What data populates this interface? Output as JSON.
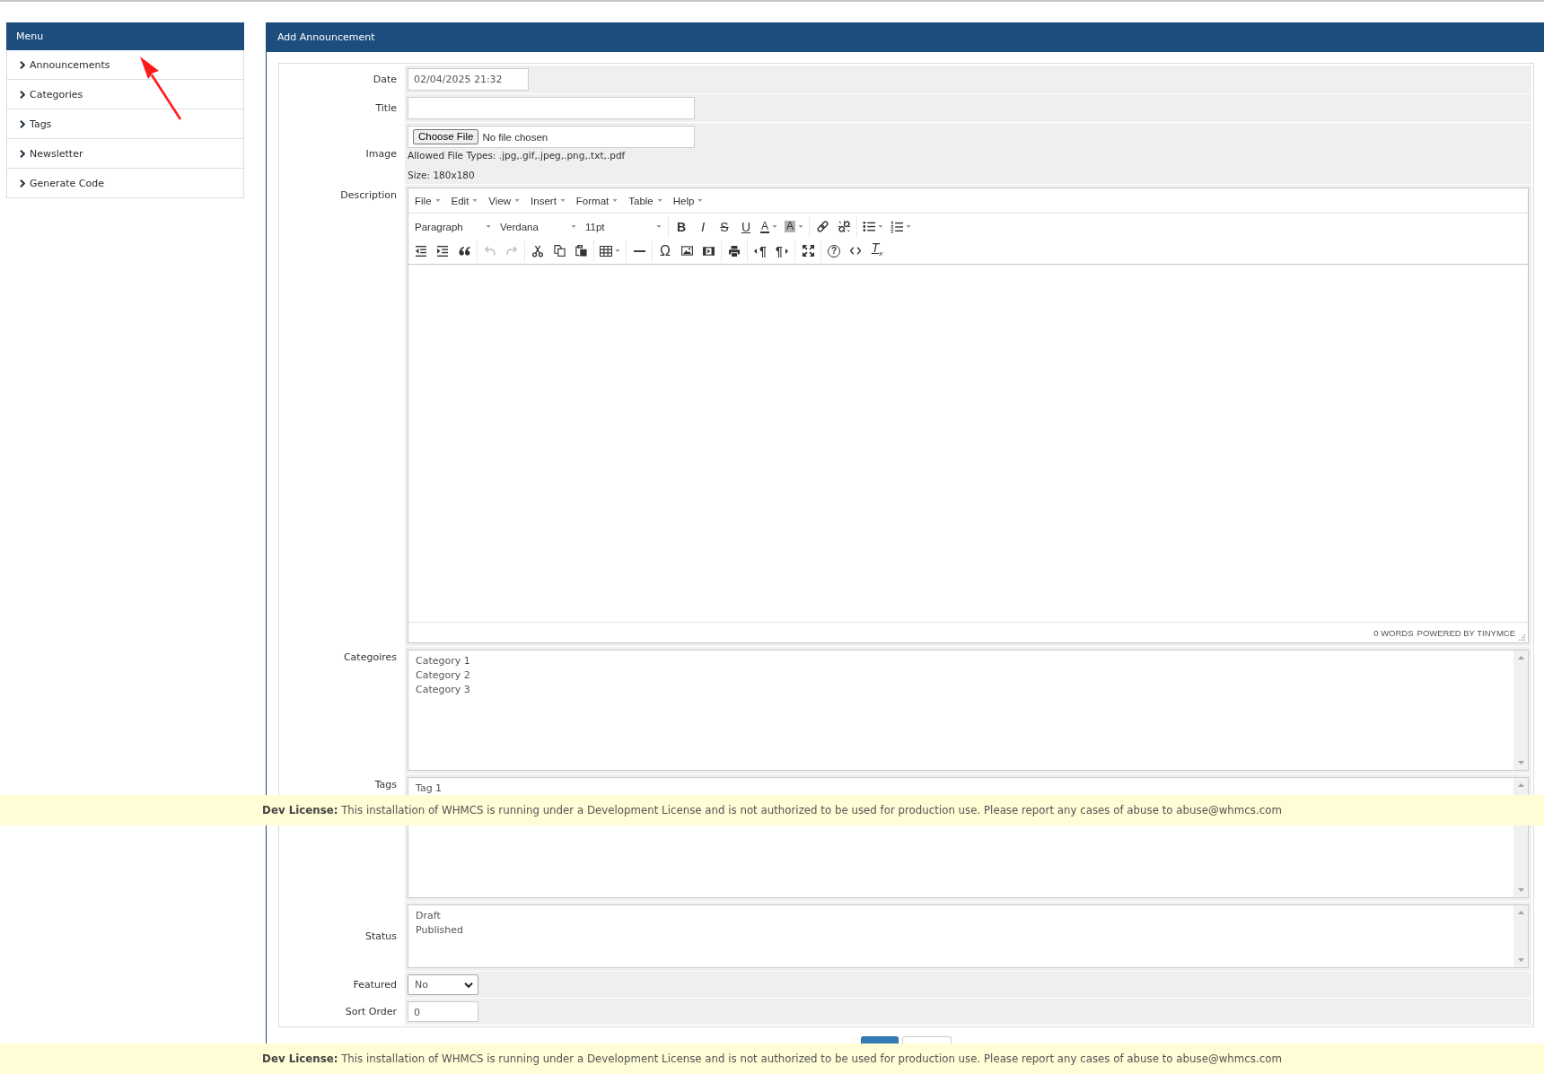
{
  "sidebar": {
    "title": "Menu",
    "items": [
      {
        "label": "Announcements"
      },
      {
        "label": "Categories"
      },
      {
        "label": "Tags"
      },
      {
        "label": "Newsletter"
      },
      {
        "label": "Generate Code"
      }
    ]
  },
  "panel": {
    "title": "Add Announcement"
  },
  "form": {
    "fields": [
      {
        "kind": "datetime",
        "label": "Date",
        "value": "02/04/2025 21:32"
      },
      {
        "kind": "text",
        "label": "Title"
      },
      {
        "kind": "file",
        "label": "Image",
        "button": "Choose File",
        "status": "No file chosen",
        "hints": [
          "Allowed File Types: .jpg,.gif,.jpeg,.png,.txt,.pdf",
          "Size: 180x180"
        ]
      },
      {
        "kind": "editor",
        "label": "Description",
        "menu": [
          {
            "label": "File"
          },
          {
            "label": "Edit"
          },
          {
            "label": "View"
          },
          {
            "label": "Insert"
          },
          {
            "label": "Format"
          },
          {
            "label": "Table"
          },
          {
            "label": "Help"
          }
        ],
        "toolbar": [
          [
            [
              {
                "kind": "blockformat",
                "text": "Paragraph",
                "disabled": false,
                "dropdown": true
              },
              {
                "kind": "fontfamily",
                "text": "Verdana",
                "disabled": false,
                "dropdown": true
              },
              {
                "kind": "fontsize",
                "text": "11pt",
                "disabled": false,
                "dropdown": true
              }
            ],
            [
              {
                "kind": "bold",
                "text": "B",
                "disabled": false,
                "dropdown": false
              },
              {
                "kind": "italic",
                "text": "I",
                "disabled": false,
                "dropdown": false
              },
              {
                "kind": "strikethrough",
                "text": "S",
                "disabled": false,
                "dropdown": false
              },
              {
                "kind": "underline",
                "text": "U",
                "disabled": false,
                "dropdown": false
              },
              {
                "kind": "forecolor",
                "text": "A",
                "disabled": false,
                "dropdown": true
              },
              {
                "kind": "backcolor",
                "text": "A",
                "disabled": false,
                "dropdown": true
              }
            ],
            [
              {
                "kind": "link",
                "disabled": false,
                "dropdown": false
              },
              {
                "kind": "unlink",
                "disabled": false,
                "dropdown": false
              }
            ],
            [
              {
                "kind": "bullist",
                "disabled": false,
                "dropdown": true
              },
              {
                "kind": "numlist",
                "disabled": false,
                "dropdown": true
              }
            ]
          ],
          [
            [
              {
                "kind": "outdent",
                "disabled": false,
                "dropdown": false
              },
              {
                "kind": "indent",
                "disabled": false,
                "dropdown": false
              },
              {
                "kind": "blockquote",
                "disabled": false,
                "dropdown": false
              }
            ],
            [
              {
                "kind": "undo",
                "disabled": true,
                "dropdown": false
              },
              {
                "kind": "redo",
                "disabled": true,
                "dropdown": false
              }
            ],
            [
              {
                "kind": "cut",
                "disabled": false,
                "dropdown": false
              },
              {
                "kind": "copy",
                "disabled": false,
                "dropdown": false
              },
              {
                "kind": "paste",
                "disabled": false,
                "dropdown": false
              }
            ],
            [
              {
                "kind": "table",
                "disabled": false,
                "dropdown": true
              }
            ],
            [
              {
                "kind": "hr",
                "disabled": false,
                "dropdown": false
              }
            ],
            [
              {
                "kind": "charmap",
                "text": "Ω",
                "disabled": false,
                "dropdown": false
              },
              {
                "kind": "image",
                "disabled": false,
                "dropdown": false
              },
              {
                "kind": "media",
                "disabled": false,
                "dropdown": false
              }
            ],
            [
              {
                "kind": "print",
                "disabled": false,
                "dropdown": false
              }
            ],
            [
              {
                "kind": "ltr",
                "text": "¶",
                "disabled": false,
                "dropdown": false
              },
              {
                "kind": "rtl",
                "text": "¶",
                "disabled": false,
                "dropdown": false
              }
            ],
            [
              {
                "kind": "fullscreen",
                "disabled": false,
                "dropdown": false
              }
            ],
            [
              {
                "kind": "help",
                "text": "?",
                "disabled": false,
                "dropdown": false
              },
              {
                "kind": "code",
                "disabled": false,
                "dropdown": false
              },
              {
                "kind": "removeformat",
                "text": "T$_{x}$",
                "disabled": false,
                "dropdown": false
              }
            ]
          ]
        ],
        "word_count": "0 WORDS",
        "branding": "POWERED BY TINYMCE"
      },
      {
        "kind": "multiselect",
        "label": "Categoires",
        "options": [
          {
            "label": "Category 1",
            "selected": false
          },
          {
            "label": "Category 2",
            "selected": false
          },
          {
            "label": "Category 3",
            "selected": false
          }
        ]
      },
      {
        "kind": "multiselect",
        "label": "Tags",
        "options": [
          {
            "label": "Tag 1",
            "selected": false
          }
        ]
      },
      {
        "kind": "listbox",
        "label": "Status",
        "options": [
          {
            "label": "Draft",
            "selected": false
          },
          {
            "label": "Published",
            "selected": false
          }
        ]
      },
      {
        "kind": "select",
        "label": "Featured",
        "value": "No"
      },
      {
        "kind": "number",
        "label": "Sort Order",
        "value": "0"
      }
    ]
  },
  "buttons": [
    {
      "kind": "primary"
    },
    {
      "kind": "secondary"
    }
  ],
  "license_notices": [
    "**Dev License:** This installation of WHMCS is running under a Development License and is not authorized to be used for production use. Please report any cases of abuse to abuse@whmcs.com",
    "**Dev License:** This installation of WHMCS is running under a Development License and is not authorized to be used for production use. Please report any cases of abuse to abuse@whmcs.com"
  ]
}
